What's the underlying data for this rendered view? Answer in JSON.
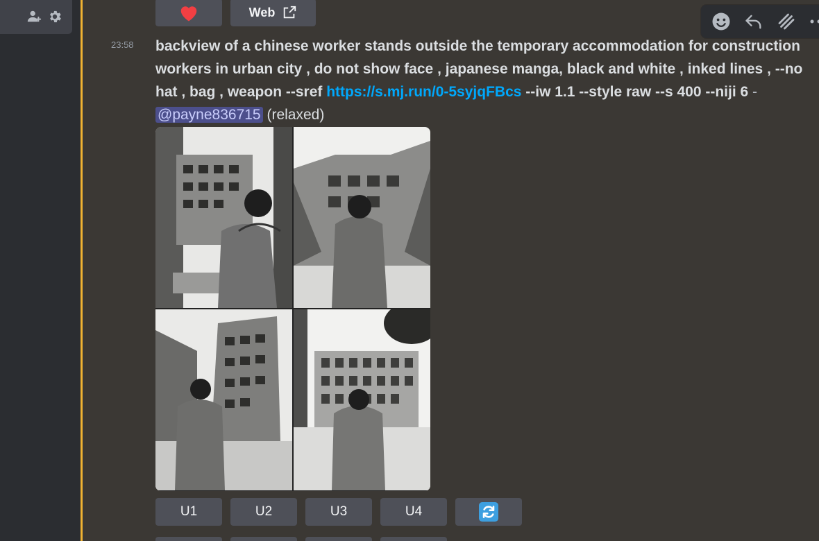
{
  "sidebar": {
    "icons": [
      "add-member-icon",
      "gear-icon"
    ]
  },
  "colors": {
    "highlight": "#f0b232",
    "link": "#00a8fc",
    "mention_bg": "#4c4f8c",
    "heart": "#f23f43"
  },
  "top_buttons": {
    "heart_icon": "heart-icon",
    "web_label": "Web"
  },
  "toolbar": {
    "icons": [
      "add-reaction-icon",
      "reply-icon",
      "thread-icon",
      "more-icon"
    ]
  },
  "message": {
    "timestamp": "23:58",
    "prompt": "backview of a chinese worker stands outside the temporary accommodation for construction workers in urban city , do not show face , japanese manga, black and white , inked lines , --no hat , bag , weapon --sref ",
    "link": "https://s.mj.run/0-5syjqFBcs",
    "params": " --iw 1.1 --style raw --s 400 --niji 6",
    "separator": " - ",
    "mention": "@payne836715",
    "status": " (relaxed)"
  },
  "actions": {
    "u1": "U1",
    "u2": "U2",
    "u3": "U3",
    "u4": "U4",
    "reroll_icon": "refresh-icon"
  }
}
